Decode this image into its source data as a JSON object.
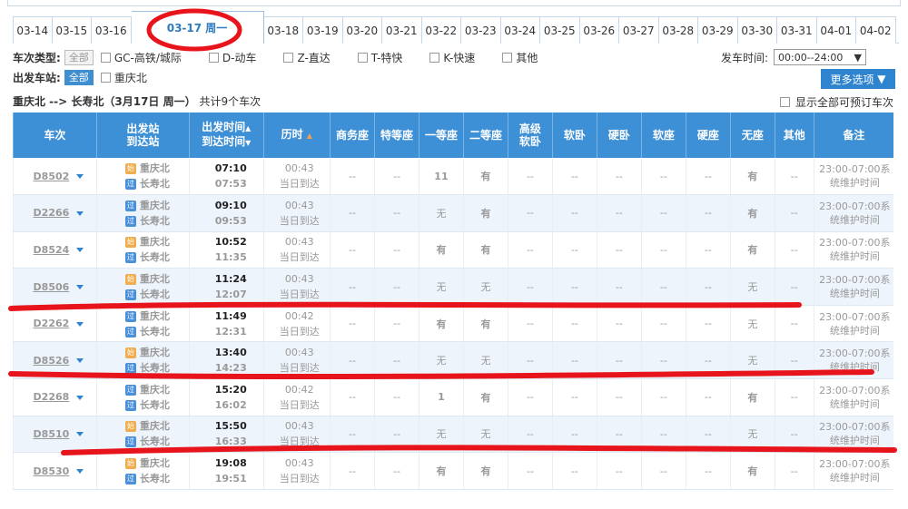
{
  "dates": [
    {
      "label": "03-14"
    },
    {
      "label": "03-15"
    },
    {
      "label": "03-16"
    },
    {
      "label": "03-17 周一",
      "active": true
    },
    {
      "label": "03-18"
    },
    {
      "label": "03-19"
    },
    {
      "label": "03-20"
    },
    {
      "label": "03-21"
    },
    {
      "label": "03-22"
    },
    {
      "label": "03-23"
    },
    {
      "label": "03-24"
    },
    {
      "label": "03-25"
    },
    {
      "label": "03-26"
    },
    {
      "label": "03-27"
    },
    {
      "label": "03-28"
    },
    {
      "label": "03-29"
    },
    {
      "label": "03-30"
    },
    {
      "label": "03-31"
    },
    {
      "label": "04-01"
    },
    {
      "label": "04-02"
    }
  ],
  "filter": {
    "type_label": "车次类型:",
    "all_label": "全部",
    "types": [
      "GC-高铁/城际",
      "D-动车",
      "Z-直达",
      "T-特快",
      "K-快速",
      "其他"
    ],
    "station_label": "出发车站:",
    "station_all": "全部",
    "stations": [
      "重庆北"
    ],
    "time_label": "发车时间:",
    "time_value": "00:00--24:00",
    "more_label": "更多选项"
  },
  "summary": {
    "route": "重庆北 --> 长寿北（3月17日  周一）",
    "count": "共计9个车次",
    "show_all": "显示全部可预订车次"
  },
  "headers": {
    "train": "车次",
    "station1": "出发站",
    "station2": "到达站",
    "time1": "出发时间",
    "time2": "到达时间",
    "duration": "历时",
    "biz": "商务座",
    "special": "特等座",
    "first": "一等座",
    "second": "二等座",
    "hsoft1": "高级",
    "hsoft2": "软卧",
    "soft_sleeper": "软卧",
    "hard_sleeper": "硬卧",
    "soft_seat": "软座",
    "hard_seat": "硬座",
    "no_seat": "无座",
    "other": "其他",
    "remark": "备注"
  },
  "badges": {
    "start": "始",
    "pass": "过"
  },
  "rows": [
    {
      "no": "D8502",
      "from": "重庆北",
      "to": "长寿北",
      "from_badge": "始",
      "to_badge": "过",
      "dep": "07:10",
      "arr": "07:53",
      "dur": "00:43",
      "day": "当日到达",
      "biz": "--",
      "special": "--",
      "first": "11",
      "second": "有",
      "hsoft": "--",
      "ss": "--",
      "hs": "--",
      "sst": "--",
      "hst": "--",
      "none": "有",
      "other": "--",
      "remark1": "23:00-07:00系",
      "remark2": "统维护时间"
    },
    {
      "no": "D2266",
      "from": "重庆北",
      "to": "长寿北",
      "from_badge": "过",
      "to_badge": "过",
      "dep": "09:10",
      "arr": "09:53",
      "dur": "00:43",
      "day": "当日到达",
      "biz": "--",
      "special": "--",
      "first": "无",
      "second": "有",
      "hsoft": "--",
      "ss": "--",
      "hs": "--",
      "sst": "--",
      "hst": "--",
      "none": "有",
      "other": "--",
      "remark1": "23:00-07:00系",
      "remark2": "统维护时间"
    },
    {
      "no": "D8524",
      "from": "重庆北",
      "to": "长寿北",
      "from_badge": "始",
      "to_badge": "过",
      "dep": "10:52",
      "arr": "11:35",
      "dur": "00:43",
      "day": "当日到达",
      "biz": "--",
      "special": "--",
      "first": "有",
      "second": "有",
      "hsoft": "--",
      "ss": "--",
      "hs": "--",
      "sst": "--",
      "hst": "--",
      "none": "有",
      "other": "--",
      "remark1": "23:00-07:00系",
      "remark2": "统维护时间"
    },
    {
      "no": "D8506",
      "from": "重庆北",
      "to": "长寿北",
      "from_badge": "始",
      "to_badge": "过",
      "dep": "11:24",
      "arr": "12:07",
      "dur": "00:43",
      "day": "当日到达",
      "biz": "--",
      "special": "--",
      "first": "无",
      "second": "无",
      "hsoft": "--",
      "ss": "--",
      "hs": "--",
      "sst": "--",
      "hst": "--",
      "none": "无",
      "other": "--",
      "remark1": "23:00-07:00系",
      "remark2": "统维护时间"
    },
    {
      "no": "D2262",
      "from": "重庆北",
      "to": "长寿北",
      "from_badge": "过",
      "to_badge": "过",
      "dep": "11:49",
      "arr": "12:31",
      "dur": "00:42",
      "day": "当日到达",
      "biz": "--",
      "special": "--",
      "first": "有",
      "second": "有",
      "hsoft": "--",
      "ss": "--",
      "hs": "--",
      "sst": "--",
      "hst": "--",
      "none": "无",
      "other": "--",
      "remark1": "23:00-07:00系",
      "remark2": "统维护时间"
    },
    {
      "no": "D8526",
      "from": "重庆北",
      "to": "长寿北",
      "from_badge": "始",
      "to_badge": "过",
      "dep": "13:40",
      "arr": "14:23",
      "dur": "00:43",
      "day": "当日到达",
      "biz": "--",
      "special": "--",
      "first": "无",
      "second": "无",
      "hsoft": "--",
      "ss": "--",
      "hs": "--",
      "sst": "--",
      "hst": "--",
      "none": "无",
      "other": "--",
      "remark1": "23:00-07:00系",
      "remark2": "统维护时间"
    },
    {
      "no": "D2268",
      "from": "重庆北",
      "to": "长寿北",
      "from_badge": "过",
      "to_badge": "过",
      "dep": "15:20",
      "arr": "16:02",
      "dur": "00:42",
      "day": "当日到达",
      "biz": "--",
      "special": "--",
      "first": "1",
      "second": "有",
      "hsoft": "--",
      "ss": "--",
      "hs": "--",
      "sst": "--",
      "hst": "--",
      "none": "有",
      "other": "--",
      "remark1": "23:00-07:00系",
      "remark2": "统维护时间"
    },
    {
      "no": "D8510",
      "from": "重庆北",
      "to": "长寿北",
      "from_badge": "始",
      "to_badge": "过",
      "dep": "15:50",
      "arr": "16:33",
      "dur": "00:43",
      "day": "当日到达",
      "biz": "--",
      "special": "--",
      "first": "无",
      "second": "无",
      "hsoft": "--",
      "ss": "--",
      "hs": "--",
      "sst": "--",
      "hst": "--",
      "none": "无",
      "other": "--",
      "remark1": "23:00-07:00系",
      "remark2": "统维护时间"
    },
    {
      "no": "D8530",
      "from": "重庆北",
      "to": "长寿北",
      "from_badge": "始",
      "to_badge": "过",
      "dep": "19:08",
      "arr": "19:51",
      "dur": "00:43",
      "day": "当日到达",
      "biz": "--",
      "special": "--",
      "first": "有",
      "second": "有",
      "hsoft": "--",
      "ss": "--",
      "hs": "--",
      "sst": "--",
      "hst": "--",
      "none": "有",
      "other": "--",
      "remark1": "23:00-07:00系",
      "remark2": "统维护时间"
    }
  ],
  "colors": {
    "header": "#3d8fd6",
    "accent": "#2e84cf",
    "available": "#1e9c3c",
    "annotation": "#e8141b"
  }
}
